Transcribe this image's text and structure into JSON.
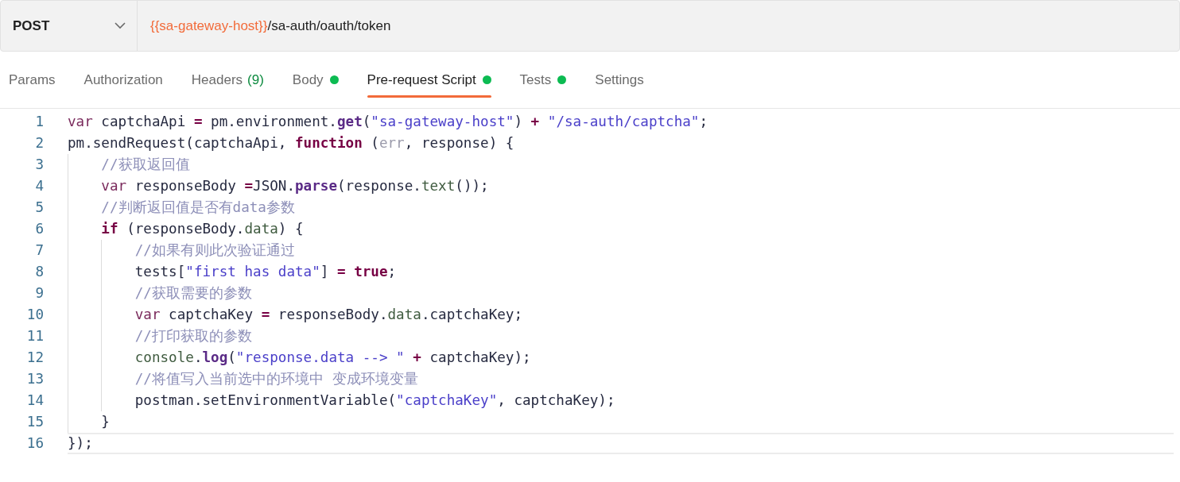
{
  "request": {
    "method": "POST",
    "url": [
      {
        "kind": "variable",
        "text": "{{sa-gateway-host}}"
      },
      {
        "kind": "path",
        "text": "/sa-auth/oauth/token"
      }
    ]
  },
  "tabs": [
    {
      "label": "Params",
      "dot": false,
      "selected": false
    },
    {
      "label": "Authorization",
      "dot": false,
      "selected": false
    },
    {
      "label": "Headers",
      "count": "(9)",
      "dot": false,
      "selected": false
    },
    {
      "label": "Body",
      "dot": true,
      "selected": false
    },
    {
      "label": "Pre-request Script",
      "dot": true,
      "selected": true
    },
    {
      "label": "Tests",
      "dot": true,
      "selected": false
    },
    {
      "label": "Settings",
      "dot": false,
      "selected": false
    }
  ],
  "editor": {
    "lines": [
      {
        "number": "1",
        "active": false,
        "tokens": [
          {
            "kind": "keyword",
            "text": "var"
          },
          {
            "kind": "plain",
            "text": " captchaApi "
          },
          {
            "kind": "operator",
            "text": "="
          },
          {
            "kind": "plain",
            "text": " pm.environment."
          },
          {
            "kind": "method",
            "text": "get"
          },
          {
            "kind": "plain",
            "text": "("
          },
          {
            "kind": "string",
            "text": "\"sa-gateway-host\""
          },
          {
            "kind": "plain",
            "text": ") "
          },
          {
            "kind": "operator",
            "text": "+"
          },
          {
            "kind": "string",
            "text": " \"/sa-auth/captcha\""
          },
          {
            "kind": "plain",
            "text": ";"
          }
        ]
      },
      {
        "number": "2",
        "active": false,
        "tokens": [
          {
            "kind": "plain",
            "text": "pm.sendRequest(captchaApi, "
          },
          {
            "kind": "bold_keyword",
            "text": "function"
          },
          {
            "kind": "plain",
            "text": " ("
          },
          {
            "kind": "param",
            "text": "err"
          },
          {
            "kind": "plain",
            "text": ", response) {"
          }
        ]
      },
      {
        "number": "3",
        "active": false,
        "tokens": [
          {
            "kind": "comment",
            "text": "    //获取返回值"
          }
        ]
      },
      {
        "number": "4",
        "active": false,
        "tokens": [
          {
            "kind": "keyword",
            "text": "    var"
          },
          {
            "kind": "plain",
            "text": " responseBody "
          },
          {
            "kind": "operator",
            "text": "="
          },
          {
            "kind": "plain",
            "text": "JSON."
          },
          {
            "kind": "method",
            "text": "parse"
          },
          {
            "kind": "plain",
            "text": "(response."
          },
          {
            "kind": "property",
            "text": "text"
          },
          {
            "kind": "plain",
            "text": "());"
          }
        ]
      },
      {
        "number": "5",
        "active": false,
        "tokens": [
          {
            "kind": "comment",
            "text": "    //判断返回值是否有data参数"
          }
        ]
      },
      {
        "number": "6",
        "active": false,
        "tokens": [
          {
            "kind": "bold_keyword",
            "text": "    if"
          },
          {
            "kind": "plain",
            "text": " (responseBody."
          },
          {
            "kind": "property",
            "text": "data"
          },
          {
            "kind": "plain",
            "text": ") {"
          }
        ]
      },
      {
        "number": "7",
        "active": false,
        "tokens": [
          {
            "kind": "comment",
            "text": "        //如果有则此次验证通过"
          }
        ]
      },
      {
        "number": "8",
        "active": false,
        "tokens": [
          {
            "kind": "plain",
            "text": "        tests["
          },
          {
            "kind": "string",
            "text": "\"first has data\""
          },
          {
            "kind": "plain",
            "text": "] "
          },
          {
            "kind": "operator",
            "text": "="
          },
          {
            "kind": "bold_keyword",
            "text": " true"
          },
          {
            "kind": "plain",
            "text": ";"
          }
        ]
      },
      {
        "number": "9",
        "active": false,
        "tokens": [
          {
            "kind": "comment",
            "text": "        //获取需要的参数"
          }
        ]
      },
      {
        "number": "10",
        "active": false,
        "tokens": [
          {
            "kind": "keyword",
            "text": "        var"
          },
          {
            "kind": "plain",
            "text": " captchaKey "
          },
          {
            "kind": "operator",
            "text": "="
          },
          {
            "kind": "plain",
            "text": " responseBody."
          },
          {
            "kind": "property",
            "text": "data"
          },
          {
            "kind": "plain",
            "text": ".captchaKey;"
          }
        ]
      },
      {
        "number": "11",
        "active": false,
        "tokens": [
          {
            "kind": "comment",
            "text": "        //打印获取的参数"
          }
        ]
      },
      {
        "number": "12",
        "active": false,
        "tokens": [
          {
            "kind": "property",
            "text": "        console"
          },
          {
            "kind": "plain",
            "text": "."
          },
          {
            "kind": "method",
            "text": "log"
          },
          {
            "kind": "plain",
            "text": "("
          },
          {
            "kind": "string",
            "text": "\"response.data --> \""
          },
          {
            "kind": "operator",
            "text": " +"
          },
          {
            "kind": "plain",
            "text": " captchaKey);"
          }
        ]
      },
      {
        "number": "13",
        "active": false,
        "tokens": [
          {
            "kind": "comment",
            "text": "        //将值写入当前选中的环境中 变成环境变量"
          }
        ]
      },
      {
        "number": "14",
        "active": false,
        "tokens": [
          {
            "kind": "plain",
            "text": "        postman.setEnvironmentVariable("
          },
          {
            "kind": "string",
            "text": "\"captchaKey\""
          },
          {
            "kind": "plain",
            "text": ", captchaKey);"
          }
        ]
      },
      {
        "number": "15",
        "active": false,
        "tokens": [
          {
            "kind": "plain",
            "text": "    }"
          }
        ]
      },
      {
        "number": "16",
        "active": true,
        "tokens": [
          {
            "kind": "plain",
            "text": "});"
          }
        ]
      }
    ]
  }
}
